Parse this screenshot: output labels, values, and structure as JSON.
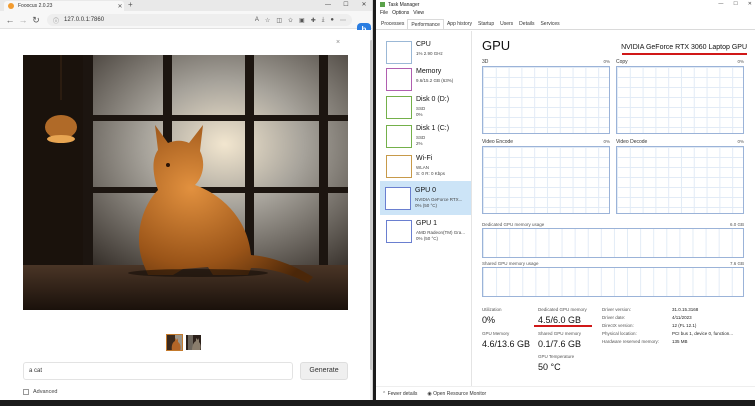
{
  "browser": {
    "tab_title": "Fooocus 2.0.23",
    "new_tab": "+",
    "url": "127.0.0.1:7860",
    "win_min": "—",
    "win_max": "☐",
    "win_close": "✕"
  },
  "page": {
    "close": "×",
    "prompt_value": "a cat",
    "generate_label": "Generate",
    "advanced_label": "Advanced"
  },
  "taskmgr": {
    "title": "Task Manager",
    "menu": [
      "File",
      "Options",
      "View"
    ],
    "tabs": [
      "Processes",
      "Performance",
      "App history",
      "Startup",
      "Users",
      "Details",
      "Services"
    ],
    "active_tab": "Performance",
    "sidebar": [
      {
        "name": "CPU",
        "sub1": "1% 2.90 GHz",
        "sub2": ""
      },
      {
        "name": "Memory",
        "sub1": "9.6/15.2 GB (63%)",
        "sub2": ""
      },
      {
        "name": "Disk 0 (D:)",
        "sub1": "SSD",
        "sub2": "0%"
      },
      {
        "name": "Disk 1 (C:)",
        "sub1": "SSD",
        "sub2": "2%"
      },
      {
        "name": "Wi-Fi",
        "sub1": "WLAN",
        "sub2": "S: 0 R: 0 Kbps"
      },
      {
        "name": "GPU 0",
        "sub1": "NVIDIA GeForce RTX...",
        "sub2": "0% (50 °C)"
      },
      {
        "name": "GPU 1",
        "sub1": "AMD Radeon(TM) Gra...",
        "sub2": "0% (50 °C)"
      }
    ],
    "gpu_heading": "GPU",
    "gpu_model": "NVIDIA GeForce RTX 3060 Laptop GPU",
    "engines": [
      {
        "label": "3D",
        "pct": "0%"
      },
      {
        "label": "Copy",
        "pct": "0%"
      },
      {
        "label": "Video Encode",
        "pct": "0%"
      },
      {
        "label": "Video Decode",
        "pct": "0%"
      }
    ],
    "dedicated_graph_label": "Dedicated GPU memory usage",
    "dedicated_graph_max": "6.0 GB",
    "shared_graph_label": "Shared GPU memory usage",
    "shared_graph_max": "7.6 GB",
    "stats": {
      "utilization_label": "Utilization",
      "utilization_value": "0%",
      "dedicated_label": "Dedicated GPU memory",
      "dedicated_value": "4.5/6.0 GB",
      "gpu_memory_label": "GPU Memory",
      "gpu_memory_value": "4.6/13.6 GB",
      "shared_label": "Shared GPU memory",
      "shared_value": "0.1/7.6 GB",
      "temp_label": "GPU Temperature",
      "temp_value": "50 °C"
    },
    "info": [
      {
        "k": "Driver version:",
        "v": "31.0.15.3168"
      },
      {
        "k": "Driver date:",
        "v": "4/11/2023"
      },
      {
        "k": "DirectX version:",
        "v": "12 (FL 12.1)"
      },
      {
        "k": "Physical location:",
        "v": "PCI bus 1, device 0, function..."
      },
      {
        "k": "Hardware reserved memory:",
        "v": "135 MB"
      }
    ],
    "footer_fewer": "Fewer details",
    "footer_monitor": "Open Resource Monitor"
  },
  "colors": {
    "highlight_red": "#d01818",
    "selected_side": "#cce4f7",
    "bing_blue": "#2a7de1"
  }
}
